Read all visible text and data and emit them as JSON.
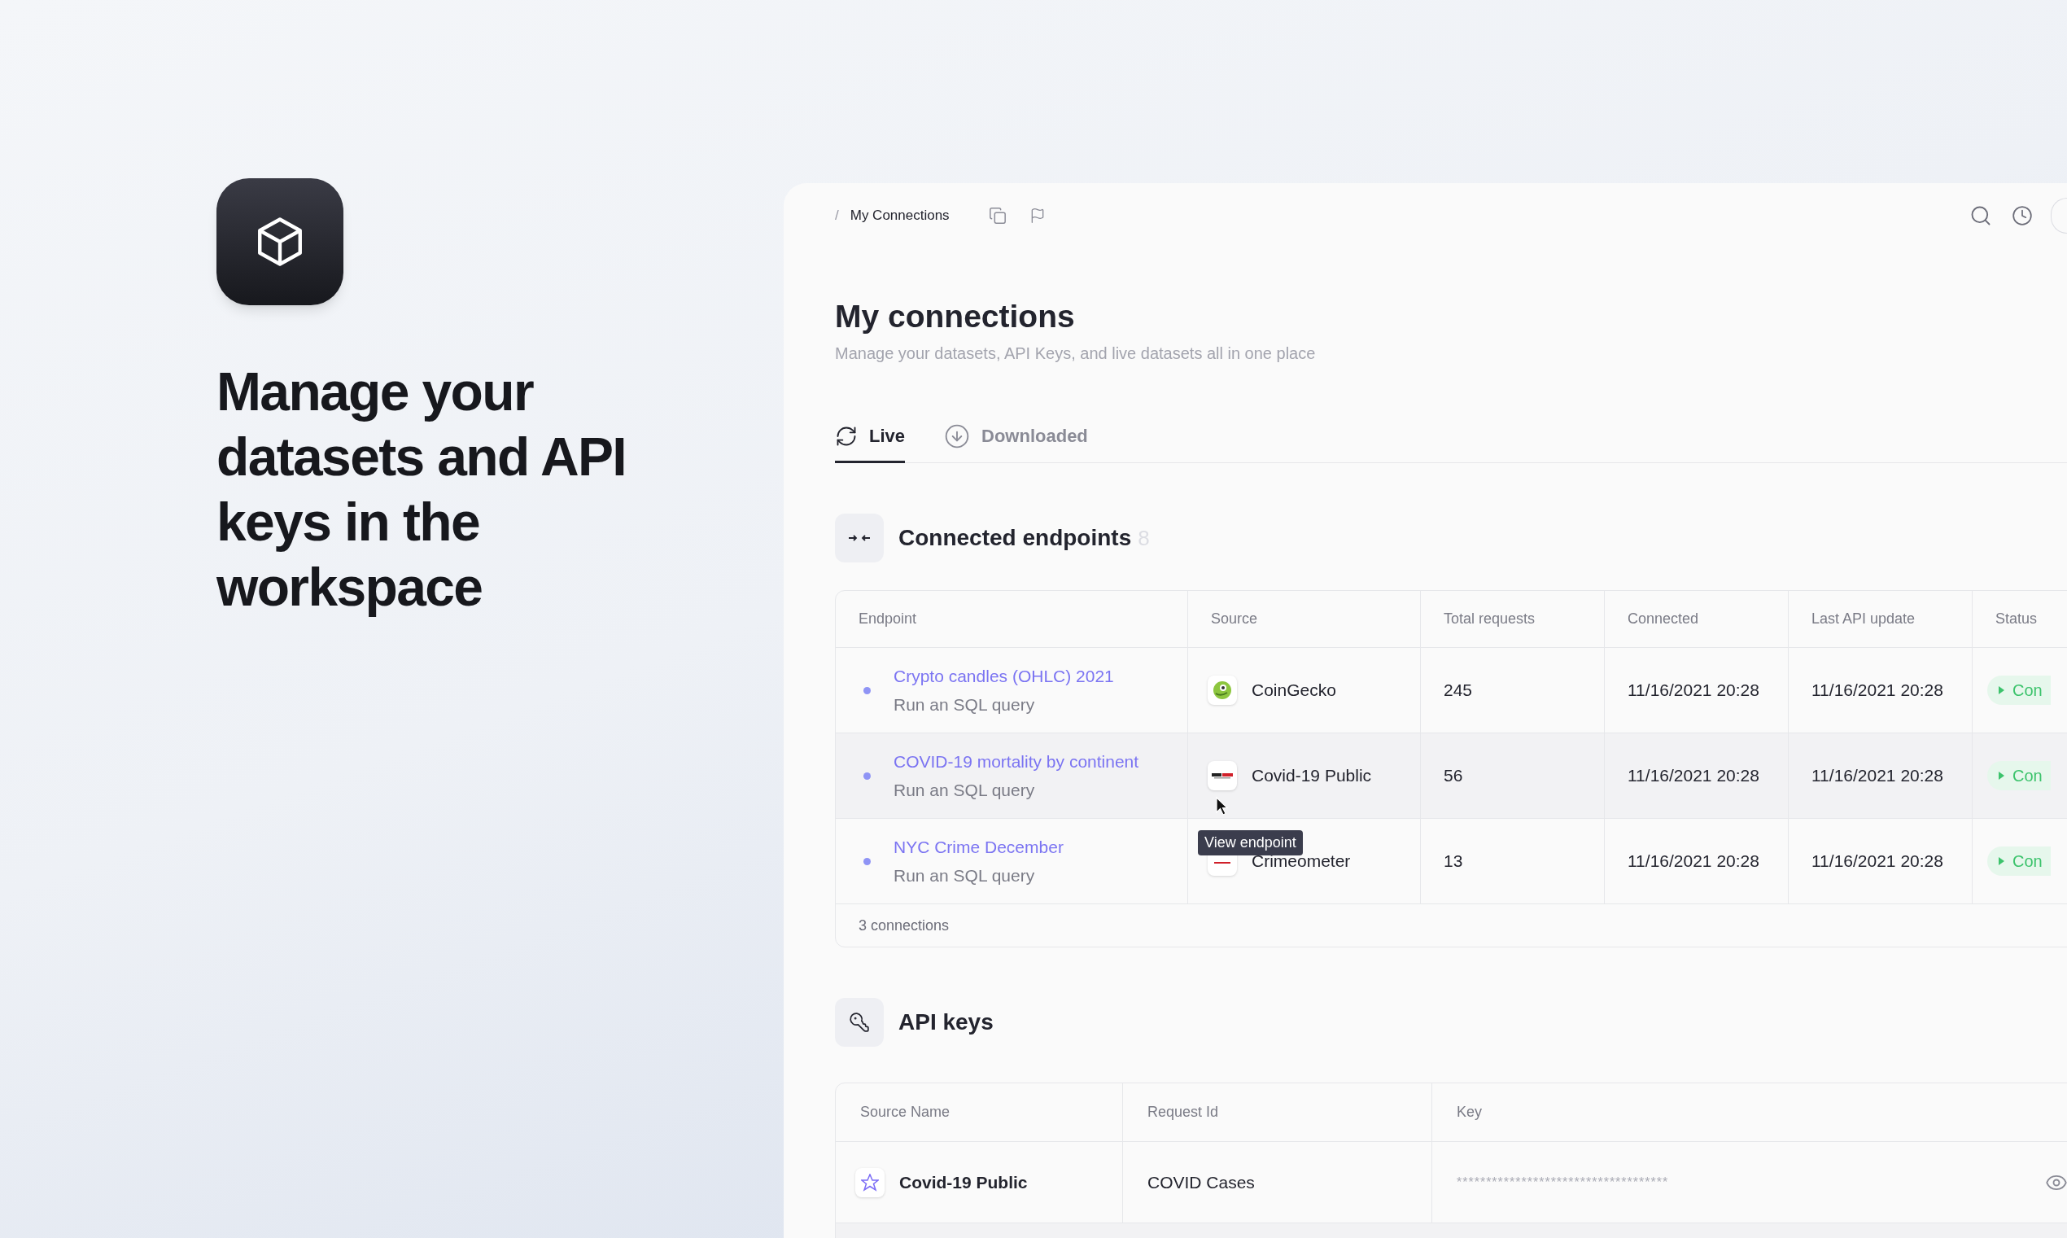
{
  "hero": {
    "headline_lines": [
      "Manage your",
      "datasets and API",
      "keys in the",
      "workspace"
    ]
  },
  "breadcrumb": {
    "separator": "/",
    "current": "My Connections"
  },
  "page": {
    "title": "My connections",
    "subtitle": "Manage your datasets, API Keys, and live datasets all in one place"
  },
  "tabs": [
    {
      "label": "Live",
      "selected": true
    },
    {
      "label": "Downloaded",
      "selected": false
    }
  ],
  "endpoints": {
    "title": "Connected endpoints",
    "count": "8",
    "columns": [
      "Endpoint",
      "Source",
      "Total requests",
      "Connected",
      "Last API update",
      "Status"
    ],
    "rows": [
      {
        "name": "Crypto candles (OHLC) 2021",
        "action": "Run an SQL query",
        "source": "CoinGecko",
        "requests": "245",
        "connected": "11/16/2021 20:28",
        "updated": "11/16/2021 20:28",
        "status": "Con",
        "highlighted": false
      },
      {
        "name": "COVID-19 mortality by continent",
        "action": "Run an SQL query",
        "source": "Covid-19 Public",
        "requests": "56",
        "connected": "11/16/2021 20:28",
        "updated": "11/16/2021 20:28",
        "status": "Con",
        "highlighted": true
      },
      {
        "name": "NYC Crime December",
        "action": "Run an SQL query",
        "source": "Crimeometer",
        "requests": "13",
        "connected": "11/16/2021 20:28",
        "updated": "11/16/2021 20:28",
        "status": "Con",
        "highlighted": false,
        "tooltip": "View endpoint"
      }
    ],
    "footer": "3 connections"
  },
  "api_keys": {
    "title": "API keys",
    "columns": [
      "Source Name",
      "Request Id",
      "Key"
    ],
    "rows": [
      {
        "source": "Covid-19 Public",
        "request_id": "COVID Cases",
        "key": "************************************"
      }
    ]
  }
}
